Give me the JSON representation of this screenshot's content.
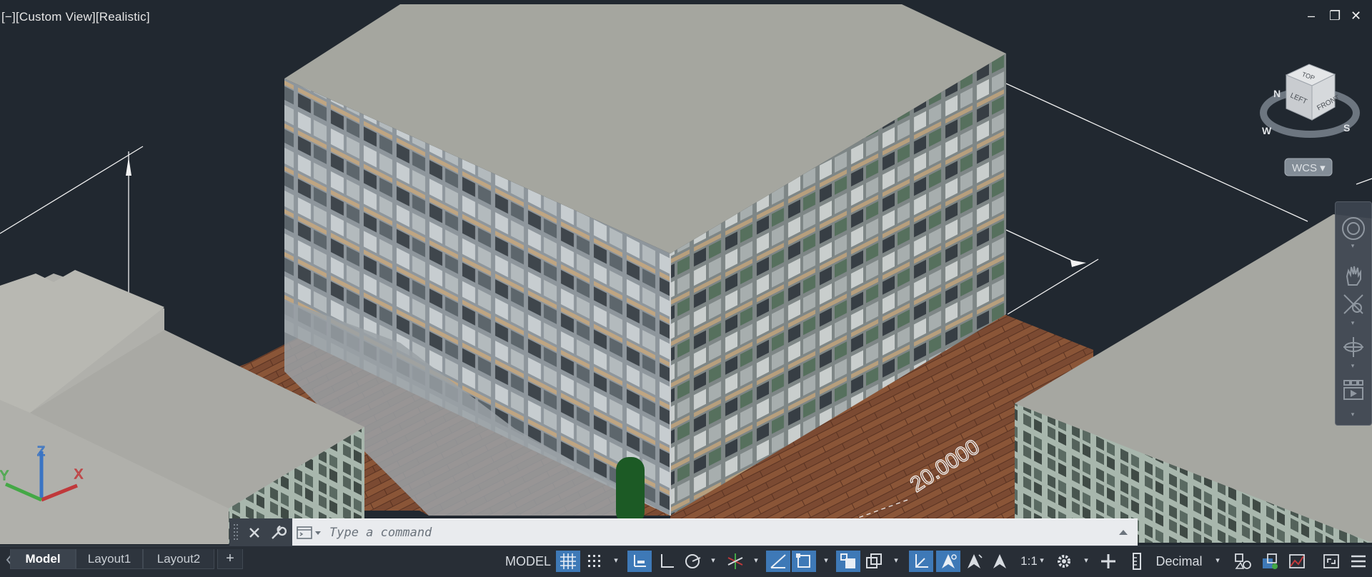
{
  "viewport": {
    "label": "[−][Custom View][Realistic]",
    "controls": {
      "minimize": "–",
      "restore": "❐",
      "close": "✕"
    }
  },
  "viewcube": {
    "faces": {
      "top": "TOP",
      "left": "LEFT",
      "front": "FRONT"
    },
    "compass": {
      "n": "N",
      "w": "W",
      "s": "S"
    },
    "ucs_menu": "WCS ▾"
  },
  "ucs_icon": {
    "x": "X",
    "y": "Y",
    "z": "Z"
  },
  "dimension": {
    "value": "20.0000"
  },
  "command_line": {
    "placeholder": "Type a command"
  },
  "layout_tabs": [
    {
      "label": "Model",
      "active": true
    },
    {
      "label": "Layout1",
      "active": false
    },
    {
      "label": "Layout2",
      "active": false
    }
  ],
  "add_tab_label": "+",
  "status": {
    "space": "MODEL",
    "annotation_scale": "1:1",
    "units": "Decimal"
  },
  "colors": {
    "background": "#212830",
    "accent_toggle": "#3e79b7",
    "roof": "#a5a69f",
    "floor": "#7a4b33"
  }
}
